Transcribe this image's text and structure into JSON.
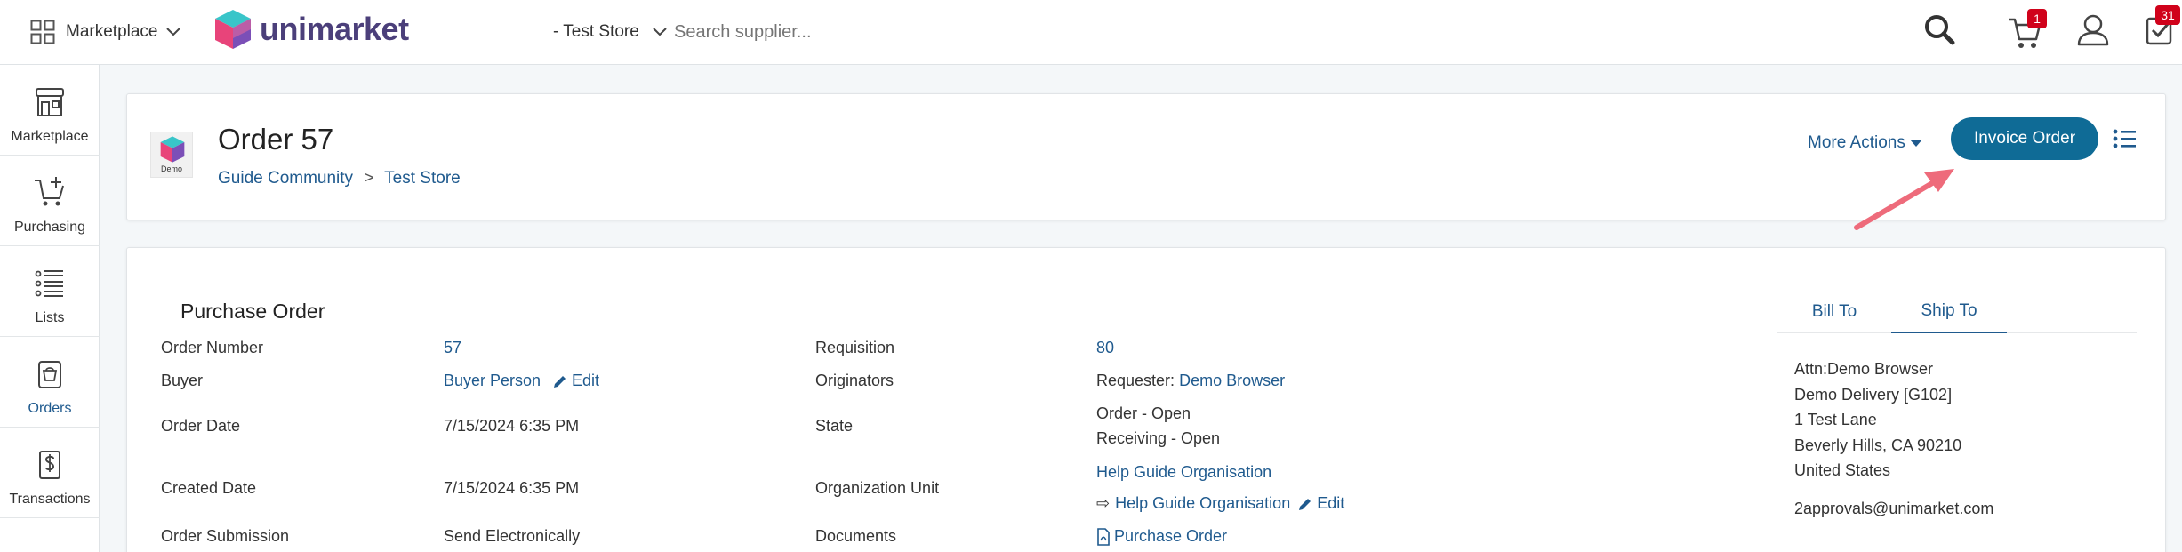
{
  "topbar": {
    "marketplace_label": "Marketplace",
    "brand": "unimarket",
    "store_selector": "- Test Store",
    "search_placeholder": "Search supplier...",
    "cart_count": "1",
    "tasks_count": "31",
    "colors": {
      "brand": "#1f5a8e",
      "badge": "#d0021b"
    }
  },
  "sidebar": {
    "items": [
      {
        "label": "Marketplace",
        "icon": "store-icon"
      },
      {
        "label": "Purchasing",
        "icon": "cart-plus-icon"
      },
      {
        "label": "Lists",
        "icon": "list-icon"
      },
      {
        "label": "Orders",
        "icon": "order-bag-icon"
      },
      {
        "label": "Transactions",
        "icon": "dollar-document-icon"
      }
    ],
    "active": "Orders"
  },
  "header": {
    "logo_text": "Demo",
    "title": "Order 57",
    "breadcrumb": [
      "Guide Community",
      ">",
      "Test Store"
    ],
    "more_actions": "More Actions",
    "invoice_button": "Invoice Order",
    "accent": "#0f6b96"
  },
  "order": {
    "section_title": "Purchase Order",
    "left": [
      {
        "label": "Order Number",
        "value": "57"
      },
      {
        "label": "Buyer",
        "value": "Buyer Person",
        "edit": "Edit"
      },
      {
        "label": "Order Date",
        "value": "7/15/2024 6:35 PM"
      },
      {
        "label": "Created Date",
        "value": "7/15/2024 6:35 PM"
      },
      {
        "label": "Order Submission",
        "value": "Send Electronically"
      }
    ],
    "middle": {
      "requisition_label": "Requisition",
      "requisition_value": "80",
      "originators_label": "Originators",
      "originators_prefix": "Requester:",
      "originators_name": "Demo Browser",
      "state_label": "State",
      "state_lines": [
        "Order - Open",
        "Receiving - Open"
      ],
      "org_label": "Organization Unit",
      "org_value": "Help Guide Organisation",
      "org_sub_arrow": "⇨",
      "org_sub_value": "Help Guide Organisation",
      "org_edit": "Edit",
      "documents_label": "Documents",
      "documents_value": "Purchase Order"
    },
    "address": {
      "tabs": [
        "Bill To",
        "Ship To"
      ],
      "active_tab": "Ship To",
      "lines": [
        "Attn:Demo Browser",
        "Demo Delivery [G102]",
        "1 Test Lane",
        "Beverly Hills, CA 90210",
        "United States"
      ],
      "email": "2approvals@unimarket.com"
    }
  }
}
